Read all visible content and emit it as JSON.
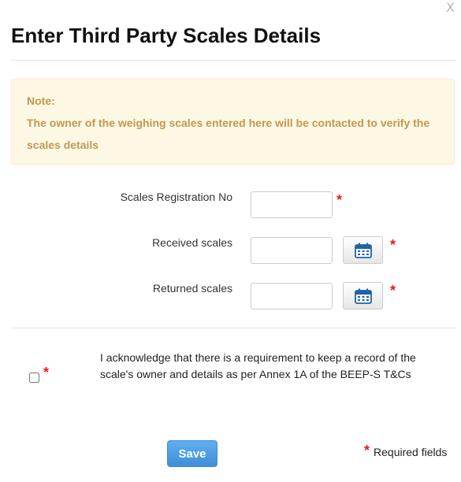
{
  "dialog": {
    "title": "Enter Third Party Scales Details",
    "close_glyph": "X"
  },
  "note": {
    "title": "Note:",
    "text": "The owner of the weighing scales entered here will be contacted to verify the scales details"
  },
  "form": {
    "fields": [
      {
        "label": "Scales Registration No",
        "value": "",
        "has_calendar": false,
        "required": true
      },
      {
        "label": "Received scales",
        "value": "",
        "has_calendar": true,
        "required": true
      },
      {
        "label": "Returned scales",
        "value": "",
        "has_calendar": true,
        "required": true
      }
    ],
    "required_marker": "*"
  },
  "acknowledgement": {
    "checked": false,
    "text": "I acknowledge that there is a requirement to keep a record of the scale's owner and details as per Annex 1A of the BEEP-S T&Cs"
  },
  "footer": {
    "save_label": "Save",
    "required_note": "Required fields"
  },
  "colors": {
    "note_bg": "#fcf8e3",
    "note_text": "#c09853",
    "required_star": "#e41e1e",
    "save_button": "#4a9ee6",
    "calendar_icon": "#1f63a8"
  },
  "icons": {
    "close": "close-icon",
    "calendar": "calendar-icon",
    "required": "asterisk-icon"
  }
}
